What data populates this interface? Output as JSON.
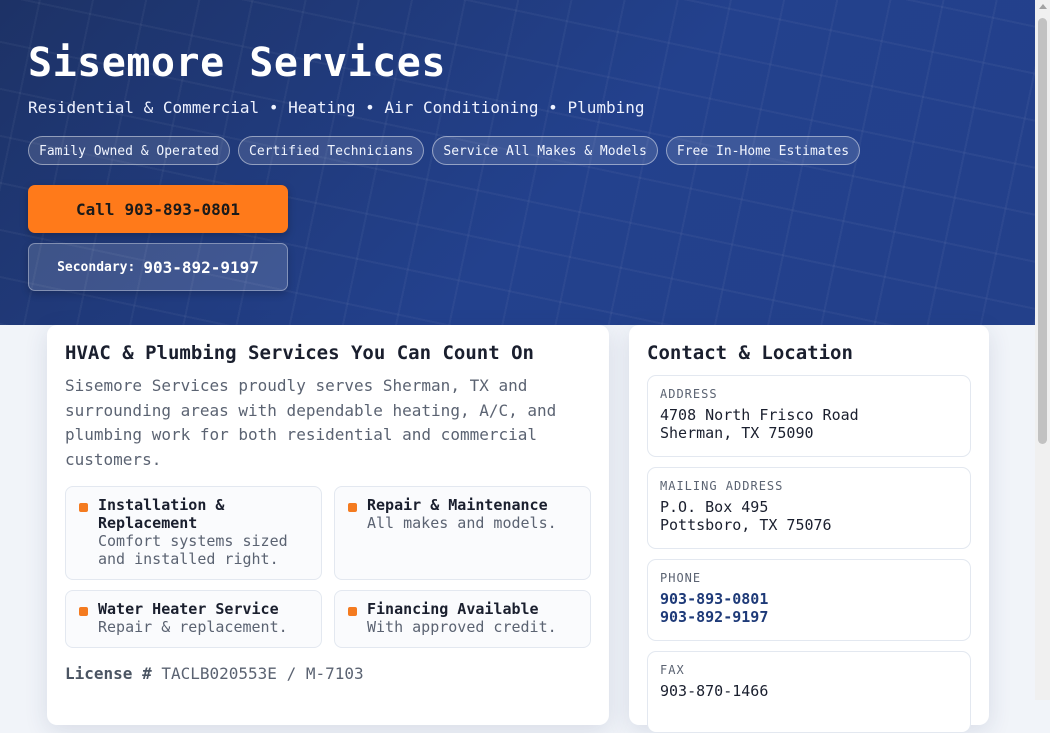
{
  "hero": {
    "title": "Sisemore Services",
    "tagline": "Residential & Commercial • Heating • Air Conditioning • Plumbing",
    "badges": [
      "Family Owned & Operated",
      "Certified Technicians",
      "Service All Makes & Models",
      "Free In-Home Estimates"
    ],
    "primary_button": {
      "label": "Call",
      "number": "903-893-0801"
    },
    "secondary_button": {
      "label": "Secondary:",
      "number": "903-892-9197"
    }
  },
  "main": {
    "heading": "HVAC & Plumbing Services You Can Count On",
    "intro": "Sisemore Services proudly serves Sherman, TX and surrounding areas with dependable heating, A/C, and plumbing work for both residential and commercial customers.",
    "services": [
      {
        "title": "Installation & Replacement",
        "desc": "Comfort systems sized and installed right."
      },
      {
        "title": "Repair & Maintenance",
        "desc": "All makes and models."
      },
      {
        "title": "Water Heater Service",
        "desc": "Repair & replacement."
      },
      {
        "title": "Financing Available",
        "desc": "With approved credit."
      }
    ],
    "license_label": "License #",
    "license_value": "TACLB020553E / M-7103"
  },
  "contact": {
    "heading": "Contact & Location",
    "address": {
      "label": "ADDRESS",
      "line1": "4708 North Frisco Road",
      "line2": "Sherman, TX 75090"
    },
    "mailing": {
      "label": "MAILING ADDRESS",
      "line1": "P.O. Box 495",
      "line2": "Pottsboro, TX 75076"
    },
    "phone": {
      "label": "PHONE",
      "primary": "903-893-0801",
      "secondary": "903-892-9197"
    },
    "fax": {
      "label": "FAX",
      "value": "903-870-1466"
    }
  },
  "colors": {
    "hero_bg": "#23418d",
    "accent": "#ff7a1a",
    "link": "#1e3a78"
  }
}
